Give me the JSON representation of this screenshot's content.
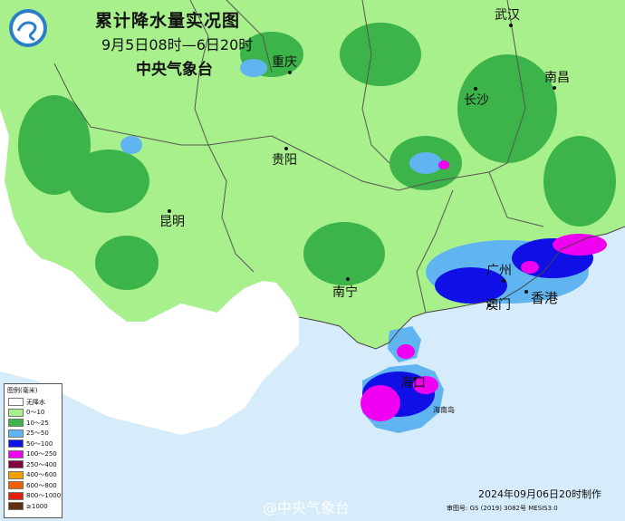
{
  "header": {
    "title": "累计降水量实况图",
    "period": "9月5日08时—6日20时",
    "agency": "中央气象台"
  },
  "cities": {
    "wuhan": "武汉",
    "chongqing": "重庆",
    "changsha": "长沙",
    "nanchang": "南昌",
    "guiyang": "贵阳",
    "kunming": "昆明",
    "guangzhou": "广州",
    "macau": "澳门",
    "hongkong": "香港",
    "nanning": "南宁",
    "haikou": "海口",
    "hainan_island": "海南岛"
  },
  "legend": {
    "title": "图例(毫米)",
    "items": [
      {
        "label": "无降水",
        "color": "#ffffff"
      },
      {
        "label": "0～10",
        "color": "#a8f08c"
      },
      {
        "label": "10～25",
        "color": "#3cb44a"
      },
      {
        "label": "25～50",
        "color": "#60b4f0"
      },
      {
        "label": "50～100",
        "color": "#1010e6"
      },
      {
        "label": "100～250",
        "color": "#f000f0"
      },
      {
        "label": "250～400",
        "color": "#800040"
      },
      {
        "label": "400～600",
        "color": "#f0a000"
      },
      {
        "label": "600～800",
        "color": "#f06000"
      },
      {
        "label": "800～1000",
        "color": "#e02010"
      },
      {
        "label": "≥1000",
        "color": "#603010"
      }
    ]
  },
  "footer": {
    "made": "2024年09月06日20时制作",
    "approval": "审图号: GS (2019) 3082号 MESIS3.0",
    "watermark": "@中央气象台"
  }
}
